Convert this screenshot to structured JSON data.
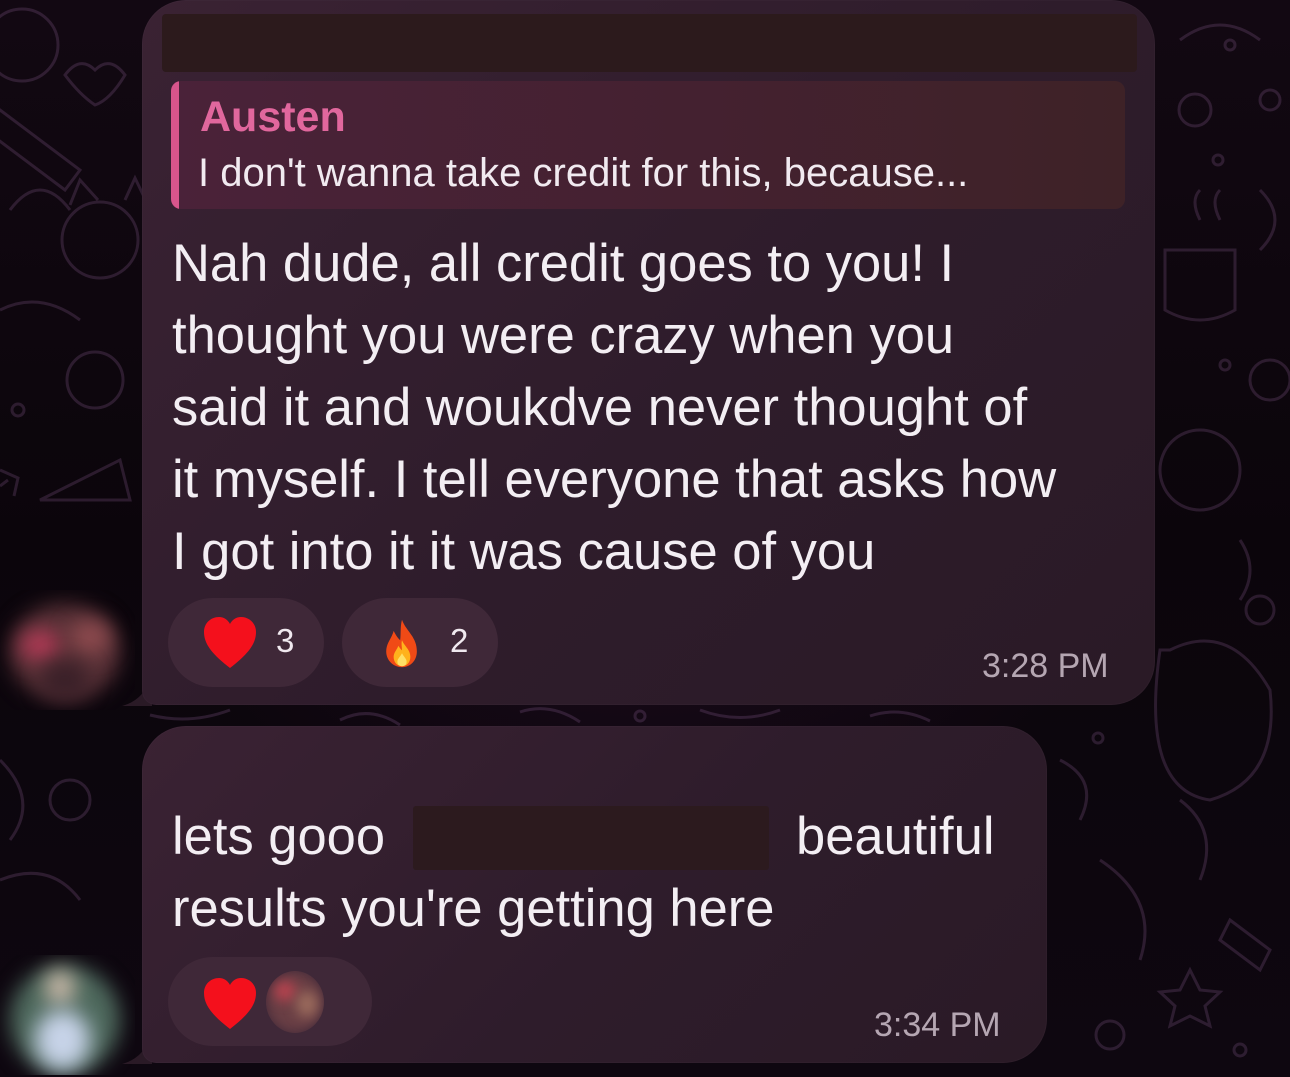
{
  "messages": [
    {
      "reply": {
        "author": "Austen",
        "snippet": "I don't wanna take credit for this, because..."
      },
      "text": "Nah dude, all credit goes to you! I\nthought you were crazy when you\nsaid it and woukdve never thought of\nit myself. I tell everyone that asks how\nI got into it it was cause of you",
      "reactions": [
        {
          "emoji": "heart-icon",
          "count": "3"
        },
        {
          "emoji": "fire-icon",
          "count": "2"
        }
      ],
      "time": "3:28 PM"
    },
    {
      "text_before": "lets gooo",
      "text_after": "beautiful",
      "text_line2": "results you're getting here",
      "reactions": [
        {
          "emoji": "heart-icon",
          "reactor": "reactor-avatar"
        }
      ],
      "time": "3:34 PM"
    }
  ],
  "colors": {
    "bubble": "#2e1c2b",
    "reply_accent": "#d8558c",
    "reply_name": "#e1679d",
    "reaction_pill": "#3f2838",
    "timestamp": "#b5a6b2"
  }
}
